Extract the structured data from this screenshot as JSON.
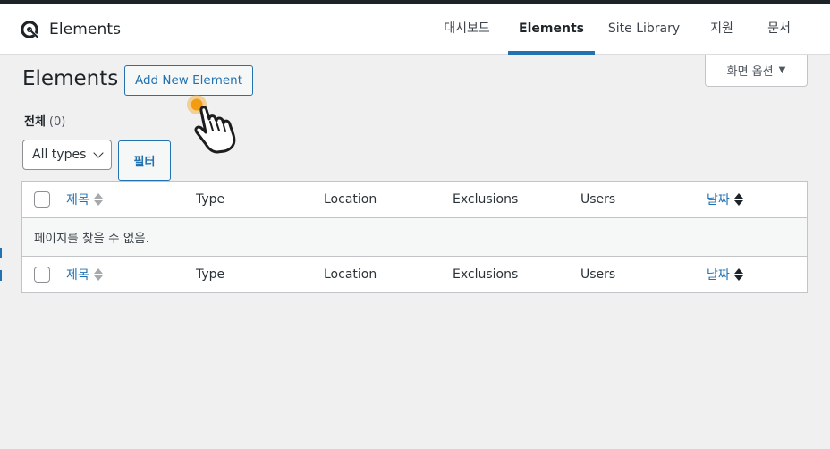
{
  "header": {
    "brand": "Elements",
    "nav": [
      {
        "label": "대시보드",
        "active": false
      },
      {
        "label": "Elements",
        "active": true
      },
      {
        "label": "Site Library",
        "active": false
      },
      {
        "label": "지원",
        "active": false
      },
      {
        "label": "문서",
        "active": false
      }
    ]
  },
  "screen_options": {
    "label": "화면 옵션",
    "arrow": "▼"
  },
  "page": {
    "title": "Elements",
    "add_new_label": "Add New Element"
  },
  "views": {
    "all_label": "전체",
    "all_count": "(0)"
  },
  "filters": {
    "type_selected": "All types",
    "filter_button": "필터"
  },
  "table": {
    "columns": [
      "제목",
      "Type",
      "Location",
      "Exclusions",
      "Users",
      "날짜"
    ],
    "empty_message": "페이지를 찾을 수 없음."
  },
  "icons": {
    "brand": "generatepress-logo-icon",
    "pointer": "hand-pointer-icon",
    "click_indicator_color": "#f5a623"
  },
  "colors": {
    "accent": "#2271b1",
    "text": "#1d2327",
    "background": "#f0f0f1"
  }
}
